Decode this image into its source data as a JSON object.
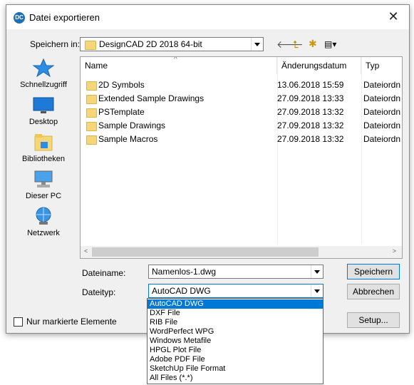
{
  "dialog": {
    "title": "Datei exportieren",
    "close_glyph": "✕",
    "app_icon_text": "DC"
  },
  "save_in": {
    "label": "Speichern in:",
    "value": "DesignCAD 2D 2018 64-bit"
  },
  "toolbar": {
    "back_glyph": "🡐",
    "up_glyph": "⮤",
    "newfolder_glyph": "✱",
    "view_glyph": "▤▾"
  },
  "places": [
    {
      "label": "Schnellzugriff",
      "icon": "star-icon"
    },
    {
      "label": "Desktop",
      "icon": "desktop-icon"
    },
    {
      "label": "Bibliotheken",
      "icon": "library-icon"
    },
    {
      "label": "Dieser PC",
      "icon": "computer-icon"
    },
    {
      "label": "Netzwerk",
      "icon": "network-icon"
    }
  ],
  "columns": {
    "name": "Name",
    "date": "Änderungsdatum",
    "type": "Typ",
    "sort_glyph": "^"
  },
  "files": [
    {
      "name": "2D Symbols",
      "date": "13.06.2018 15:59",
      "type": "Dateiordn"
    },
    {
      "name": "Extended Sample Drawings",
      "date": "27.09.2018 13:33",
      "type": "Dateiordn"
    },
    {
      "name": "PSTemplate",
      "date": "27.09.2018 13:32",
      "type": "Dateiordn"
    },
    {
      "name": "Sample Drawings",
      "date": "27.09.2018 13:32",
      "type": "Dateiordn"
    },
    {
      "name": "Sample Macros",
      "date": "27.09.2018 13:32",
      "type": "Dateiordn"
    }
  ],
  "scroll": {
    "left_glyph": "<",
    "right_glyph": ">"
  },
  "filename": {
    "label": "Dateiname:",
    "value": "Namenlos-1.dwg"
  },
  "filetype": {
    "label": "Dateityp:",
    "value": "AutoCAD DWG"
  },
  "buttons": {
    "save": "Speichern",
    "cancel": "Abbrechen",
    "setup": "Setup..."
  },
  "marked_only": {
    "label": "Nur markierte Elemente",
    "checked": false
  },
  "filetype_options": [
    "AutoCAD DWG",
    "DXF File",
    "RIB File",
    "WordPerfect WPG",
    "Windows Metafile",
    "HPGL Plot File",
    "Adobe PDF File",
    "SketchUp File Format",
    "All Files (*.*)"
  ],
  "selected_option_index": 0,
  "colors": {
    "selection": "#0078d7",
    "folder": "#f5d77a",
    "accent": "#1f6fb5"
  }
}
